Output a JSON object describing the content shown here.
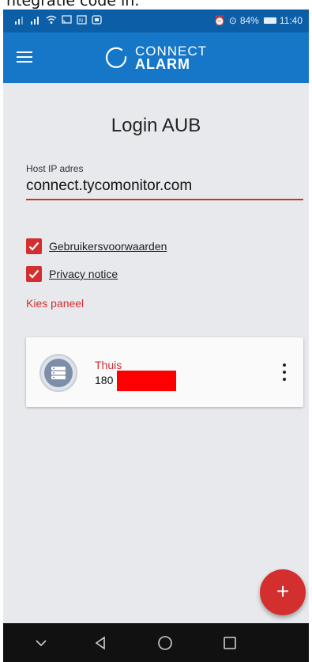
{
  "caption": {
    "text": "ntegratie code in."
  },
  "status_bar": {
    "alarm_glyph": "⏰",
    "location_glyph": "⊙",
    "battery_percent": "84%",
    "time": "11:40"
  },
  "app_bar": {
    "menu_icon": "hamburger-menu-icon",
    "brand_top": "CONNECT",
    "brand_bottom": "ALARM"
  },
  "login": {
    "title": "Login AUB",
    "host_label": "Host IP adres",
    "host_value": "connect.tycomonitor.com"
  },
  "checkboxes": [
    {
      "label": "Gebruikersvoorwaarden",
      "checked": true
    },
    {
      "label": "Privacy notice",
      "checked": true
    }
  ],
  "panels": {
    "section_label": "Kies paneel",
    "items": [
      {
        "name": "Thuis",
        "id_visible": "180",
        "id_redacted": true
      }
    ]
  },
  "fab": {
    "label": "+"
  },
  "colors": {
    "status_bar": "#0c5fa7",
    "app_bar": "#1677c8",
    "accent": "#d32f2f",
    "background": "#e8e9ed",
    "nav_bar": "#111111",
    "redaction": "#ff0000"
  }
}
